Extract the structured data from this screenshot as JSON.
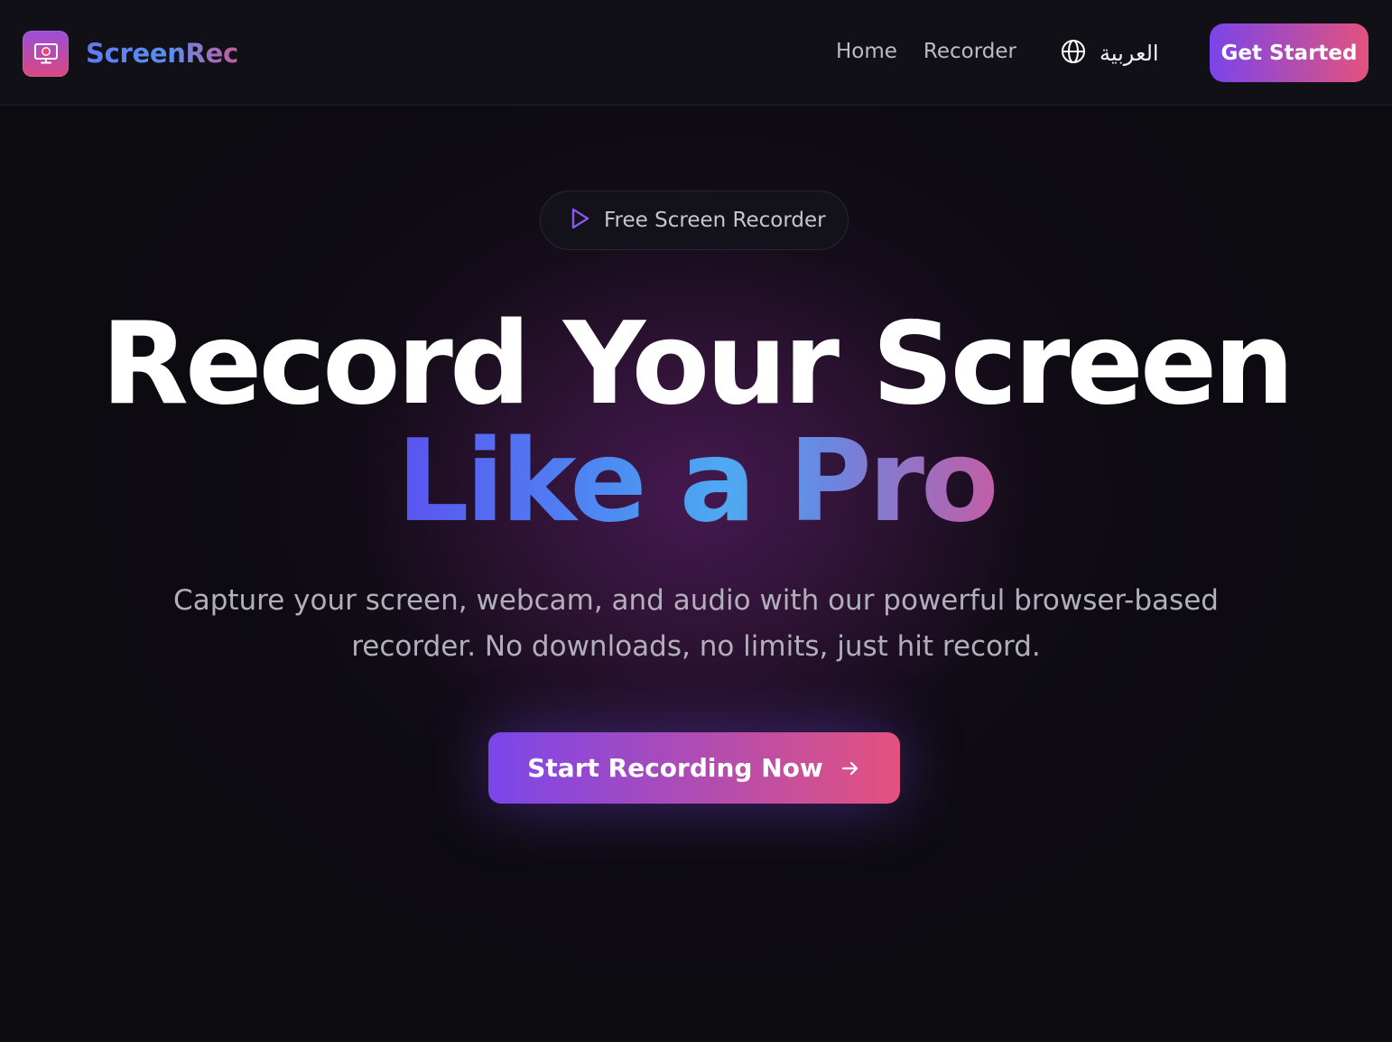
{
  "brand": {
    "name": "ScreenRec",
    "logo_icon": "monitor-record-icon"
  },
  "nav": {
    "links": [
      "Home",
      "Recorder"
    ],
    "language_icon": "globe-icon",
    "language_label": "العربية",
    "cta_label": "Get Started"
  },
  "badge": {
    "icon": "play-icon",
    "label": "Free Screen Recorder"
  },
  "hero": {
    "title_line1": "Record Your Screen",
    "title_line2": "Like a Pro",
    "subtitle": "Capture your screen, webcam, and audio with our powerful browser-based recorder. No downloads, no limits, just hit record.",
    "cta_label": "Start Recording Now",
    "cta_icon": "arrow-right-icon"
  },
  "colors": {
    "background": "#0c0b10",
    "navbar": "#111016",
    "gradient_start": "#7b46ea",
    "gradient_end": "#e3527e",
    "brand_blue": "#5f7bf5",
    "muted_text": "#b1afba"
  }
}
